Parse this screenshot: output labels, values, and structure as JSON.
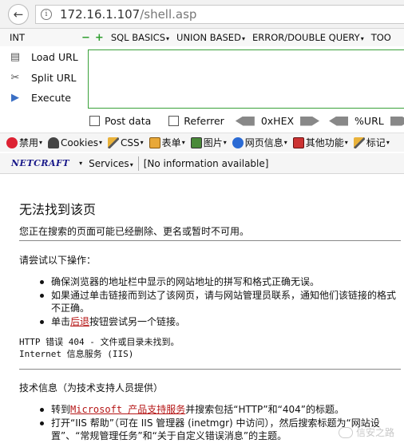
{
  "address_bar": {
    "url_host": "172.16.1.107",
    "url_path": "/shell.asp"
  },
  "hackbar": {
    "int_label": "INT",
    "menus": [
      "SQL BASICS",
      "UNION BASED",
      "ERROR/DOUBLE QUERY",
      "TOO"
    ],
    "actions": [
      "Load URL",
      "Split URL",
      "Execute"
    ],
    "post_data_label": "Post data",
    "referrer_label": "Referrer",
    "hex_label": "0xHEX",
    "url_label": "%URL"
  },
  "webdev": {
    "items": [
      "禁用",
      "Cookies",
      "CSS",
      "表单",
      "图片",
      "网页信息",
      "其他功能",
      "标记"
    ]
  },
  "netcraft": {
    "logo_text": "NETCRAFT",
    "services_label": "Services",
    "info_text": "[No information available]"
  },
  "page": {
    "title": "无法找到该页",
    "subtitle": "您正在搜索的页面可能已经删除、更名或暂时不可用。",
    "section1_head": "请尝试以下操作：",
    "bullets1": [
      "确保浏览器的地址栏中显示的网站地址的拼写和格式正确无误。",
      "如果通过单击链接而到达了该网页，请与网站管理员联系，通知他们该链接的格式不正确。"
    ],
    "bullet3_prefix": "单击",
    "bullet3_link": "后退",
    "bullet3_suffix": "按钮尝试另一个链接。",
    "error_line1": "HTTP 错误 404 - 文件或目录未找到。",
    "error_line2": "Internet 信息服务 (IIS)",
    "section2_head": "技术信息（为技术支持人员提供）",
    "bullet_a_prefix": "转到",
    "bullet_a_link": "Microsoft 产品支持服务",
    "bullet_a_suffix": "并搜索包括“HTTP”和“404”的标题。",
    "bullet_b": "打开“IIS 帮助”（可在 IIS 管理器 (inetmgr) 中访问），然后搜索标题为“网站设置”、“常规管理任务”和“关于自定义错误消息”的主题。",
    "watermark": "信安之路"
  }
}
